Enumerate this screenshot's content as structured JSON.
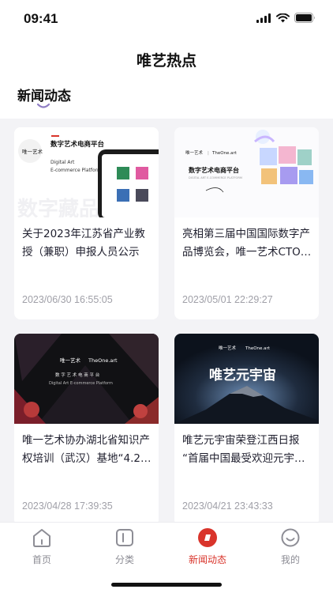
{
  "status_bar": {
    "time": "09:41"
  },
  "header": {
    "title": "唯艺热点"
  },
  "section": {
    "title": "新闻动态"
  },
  "colors": {
    "accent": "#d9342b",
    "underline": "#8e7cc3",
    "background": "#f3f3f6"
  },
  "cards": [
    {
      "title_line1": "关于2023年江苏省产业教",
      "title_line2": "授（兼职）申报人员公示",
      "date": "2023/06/30 16:55:05",
      "image": {
        "logo": "唯一艺术",
        "platform_cn": "数字艺术电商平台",
        "platform_en1": "Digital Art",
        "platform_en2": "E-commerce Platform",
        "watermark": "数字藏品"
      }
    },
    {
      "title_line1": "亮相第三届中国国际数字产",
      "title_line2": "品博览会，唯一艺术CTO…",
      "date": "2023/05/01 22:29:27",
      "image": {
        "logo": "唯一艺术",
        "logo_divider": "|",
        "brand": "TheOne.art",
        "platform_cn": "数字艺术电商平台",
        "platform_en": "DIGITAL ART E-COMMERCE PLATFORM"
      }
    },
    {
      "title_line1": "唯一艺术协办湖北省知识产",
      "title_line2": "权培训（武汉）基地“4.2…",
      "date": "2023/04/28 17:39:35",
      "image": {
        "logo": "唯一艺术",
        "brand": "TheOne.art",
        "platform_cn": "数 字 艺 术 电 商 平 台",
        "platform_en": "Digital Art E-commerce Platform"
      }
    },
    {
      "title_line1": "唯艺元宇宙荣登江西日报",
      "title_line2": "“首届中国最受欢迎元宇…",
      "date": "2023/04/21 23:43:33",
      "image": {
        "logo": "唯一艺术",
        "brand": "TheOne.art",
        "headline": "唯艺元宇宙"
      }
    }
  ],
  "tabbar": {
    "items": [
      {
        "label": "首页",
        "icon": "home-icon"
      },
      {
        "label": "分类",
        "icon": "category-icon"
      },
      {
        "label": "新闻动态",
        "icon": "news-icon",
        "active": true
      },
      {
        "label": "我的",
        "icon": "profile-icon"
      }
    ]
  }
}
